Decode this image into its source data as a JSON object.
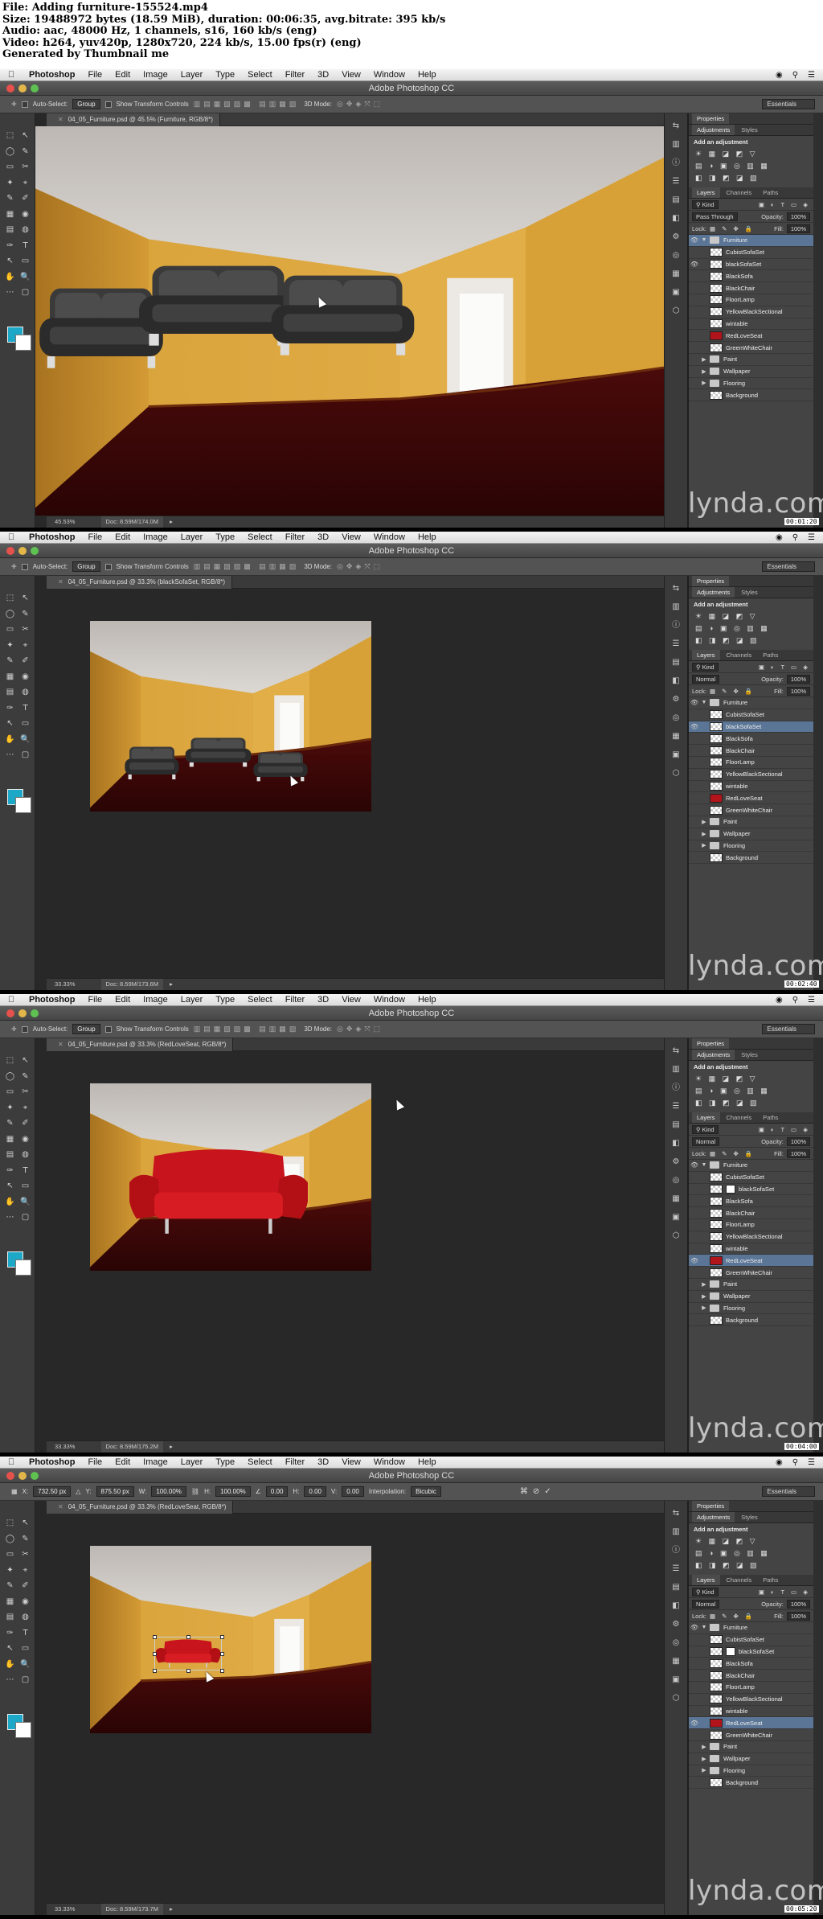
{
  "header": {
    "line1": "File: Adding furniture-155524.mp4",
    "line2": "Size: 19488972 bytes (18.59 MiB), duration: 00:06:35, avg.bitrate: 395 kb/s",
    "line3": "Audio: aac, 48000 Hz, 1 channels, s16, 160 kb/s (eng)",
    "line4": "Video: h264, yuv420p, 1280x720, 224 kb/s, 15.00 fps(r) (eng)",
    "line5": "Generated by Thumbnail me"
  },
  "app": {
    "name": "Photoshop",
    "window_title": "Adobe Photoshop CC",
    "menus": [
      "File",
      "Edit",
      "Image",
      "Layer",
      "Type",
      "Select",
      "Filter",
      "3D",
      "View",
      "Window",
      "Help"
    ],
    "options": {
      "auto_select": "Auto-Select:",
      "group": "Group",
      "show_transform": "Show Transform Controls",
      "mode_3d": "3D Mode:",
      "workspace": "Essentials"
    },
    "transform_options": {
      "x_label": "X:",
      "x": "732.50 px",
      "y_label": "Y:",
      "y": "875.50 px",
      "w_label": "W:",
      "w": "100.00%",
      "h_label": "H:",
      "h": "100.00%",
      "angle": "0.00",
      "hskew_label": "H:",
      "hskew": "0.00",
      "vskew_label": "V:",
      "vskew": "0.00",
      "interp_label": "Interpolation:",
      "interp": "Bicubic"
    },
    "panels": {
      "properties": "Properties",
      "adjustments": "Adjustments",
      "styles": "Styles",
      "add_adjustment": "Add an adjustment",
      "layers": "Layers",
      "channels": "Channels",
      "paths": "Paths",
      "kind": "Kind",
      "opacity_label": "Opacity:",
      "opacity": "100%",
      "lock_label": "Lock:",
      "fill_label": "Fill:",
      "fill": "100%"
    },
    "watermark": "lynda.com"
  },
  "frames": [
    {
      "tab": "04_05_Furniture.psd @ 45.5% (Furniture, RGB/8*)",
      "zoom": "45.53%",
      "doc": "Doc: 8.59M/174.0M",
      "blend": "Pass Through",
      "time": "00:01:20",
      "selected": "Furniture",
      "layers": [
        {
          "name": "Furniture",
          "kind": "group-open",
          "eye": true
        },
        {
          "name": "CubistSofaSet",
          "kind": "layer"
        },
        {
          "name": "blackSofaSet",
          "kind": "layer",
          "eye": true
        },
        {
          "name": "BlackSofa",
          "kind": "layer"
        },
        {
          "name": "BlackChair",
          "kind": "layer"
        },
        {
          "name": "FloorLamp",
          "kind": "layer"
        },
        {
          "name": "YellowBlackSectional",
          "kind": "layer"
        },
        {
          "name": "wintable",
          "kind": "layer"
        },
        {
          "name": "RedLoveSeat",
          "kind": "layer",
          "thumb": "red"
        },
        {
          "name": "GreenWhiteChair",
          "kind": "layer"
        },
        {
          "name": "Paint",
          "kind": "group"
        },
        {
          "name": "Wallpaper",
          "kind": "group"
        },
        {
          "name": "Flooring",
          "kind": "group"
        },
        {
          "name": "Background",
          "kind": "layer"
        }
      ]
    },
    {
      "tab": "04_05_Furniture.psd @ 33.3% (blackSofaSet, RGB/8*)",
      "zoom": "33.33%",
      "doc": "Doc: 8.59M/173.6M",
      "blend": "Normal",
      "time": "00:02:40",
      "selected": "blackSofaSet",
      "layers": [
        {
          "name": "Furniture",
          "kind": "group-open",
          "eye": true
        },
        {
          "name": "CubistSofaSet",
          "kind": "layer"
        },
        {
          "name": "blackSofaSet",
          "kind": "layer",
          "eye": true
        },
        {
          "name": "BlackSofa",
          "kind": "layer"
        },
        {
          "name": "BlackChair",
          "kind": "layer"
        },
        {
          "name": "FloorLamp",
          "kind": "layer"
        },
        {
          "name": "YellowBlackSectional",
          "kind": "layer"
        },
        {
          "name": "wintable",
          "kind": "layer"
        },
        {
          "name": "RedLoveSeat",
          "kind": "layer",
          "thumb": "red"
        },
        {
          "name": "GreenWhiteChair",
          "kind": "layer"
        },
        {
          "name": "Paint",
          "kind": "group"
        },
        {
          "name": "Wallpaper",
          "kind": "group"
        },
        {
          "name": "Flooring",
          "kind": "group"
        },
        {
          "name": "Background",
          "kind": "layer"
        }
      ]
    },
    {
      "tab": "04_05_Furniture.psd @ 33.3% (RedLoveSeat, RGB/8*)",
      "zoom": "33.33%",
      "doc": "Doc: 8.59M/175.2M",
      "blend": "Normal",
      "time": "00:04:00",
      "selected": "RedLoveSeat",
      "layers": [
        {
          "name": "Furniture",
          "kind": "group-open",
          "eye": true
        },
        {
          "name": "CubistSofaSet",
          "kind": "layer"
        },
        {
          "name": "blackSofaSet",
          "kind": "layer",
          "mask": true
        },
        {
          "name": "BlackSofa",
          "kind": "layer"
        },
        {
          "name": "BlackChair",
          "kind": "layer"
        },
        {
          "name": "FloorLamp",
          "kind": "layer"
        },
        {
          "name": "YellowBlackSectional",
          "kind": "layer"
        },
        {
          "name": "wintable",
          "kind": "layer"
        },
        {
          "name": "RedLoveSeat",
          "kind": "layer",
          "thumb": "red",
          "eye": true
        },
        {
          "name": "GreenWhiteChair",
          "kind": "layer"
        },
        {
          "name": "Paint",
          "kind": "group"
        },
        {
          "name": "Wallpaper",
          "kind": "group"
        },
        {
          "name": "Flooring",
          "kind": "group"
        },
        {
          "name": "Background",
          "kind": "layer"
        }
      ]
    },
    {
      "tab": "04_05_Furniture.psd @ 33.3% (RedLoveSeat, RGB/8*)",
      "zoom": "33.33%",
      "doc": "Doc: 8.59M/173.7M",
      "blend": "Normal",
      "time": "00:05:20",
      "selected": "RedLoveSeat",
      "layers": [
        {
          "name": "Furniture",
          "kind": "group-open",
          "eye": true
        },
        {
          "name": "CubistSofaSet",
          "kind": "layer"
        },
        {
          "name": "blackSofaSet",
          "kind": "layer",
          "mask": true
        },
        {
          "name": "BlackSofa",
          "kind": "layer"
        },
        {
          "name": "BlackChair",
          "kind": "layer"
        },
        {
          "name": "FloorLamp",
          "kind": "layer"
        },
        {
          "name": "YellowBlackSectional",
          "kind": "layer"
        },
        {
          "name": "wintable",
          "kind": "layer"
        },
        {
          "name": "RedLoveSeat",
          "kind": "layer",
          "thumb": "red",
          "eye": true
        },
        {
          "name": "GreenWhiteChair",
          "kind": "layer"
        },
        {
          "name": "Paint",
          "kind": "group"
        },
        {
          "name": "Wallpaper",
          "kind": "group"
        },
        {
          "name": "Flooring",
          "kind": "group"
        },
        {
          "name": "Background",
          "kind": "layer"
        }
      ]
    }
  ]
}
